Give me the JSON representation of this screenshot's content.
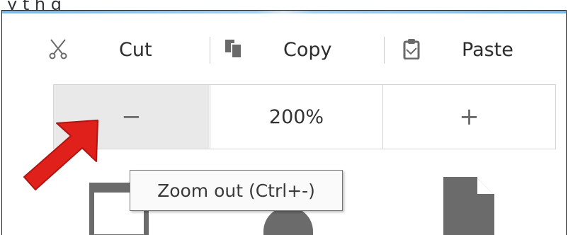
{
  "caption": {
    "text": "y     t  h  g"
  },
  "edit_row": {
    "cut": {
      "label": "Cut",
      "icon": "scissors-icon"
    },
    "copy": {
      "label": "Copy",
      "icon": "copy-icon"
    },
    "paste": {
      "label": "Paste",
      "icon": "clipboard-icon"
    }
  },
  "zoom_row": {
    "zoom_out_symbol": "−",
    "zoom_level": "200%",
    "zoom_in_symbol": "+"
  },
  "tooltip": {
    "text": "Zoom out (Ctrl+-)"
  },
  "annotation": {
    "arrow_color": "#e0201b",
    "arrow_icon": "red-arrow-icon"
  },
  "lower_icons": [
    "new-window-icon",
    "private-window-icon",
    "new-document-icon"
  ],
  "colors": {
    "accent": "#e0201b",
    "icon_gray": "#6b6b6b",
    "pressed_bg": "#e9e9e9"
  }
}
